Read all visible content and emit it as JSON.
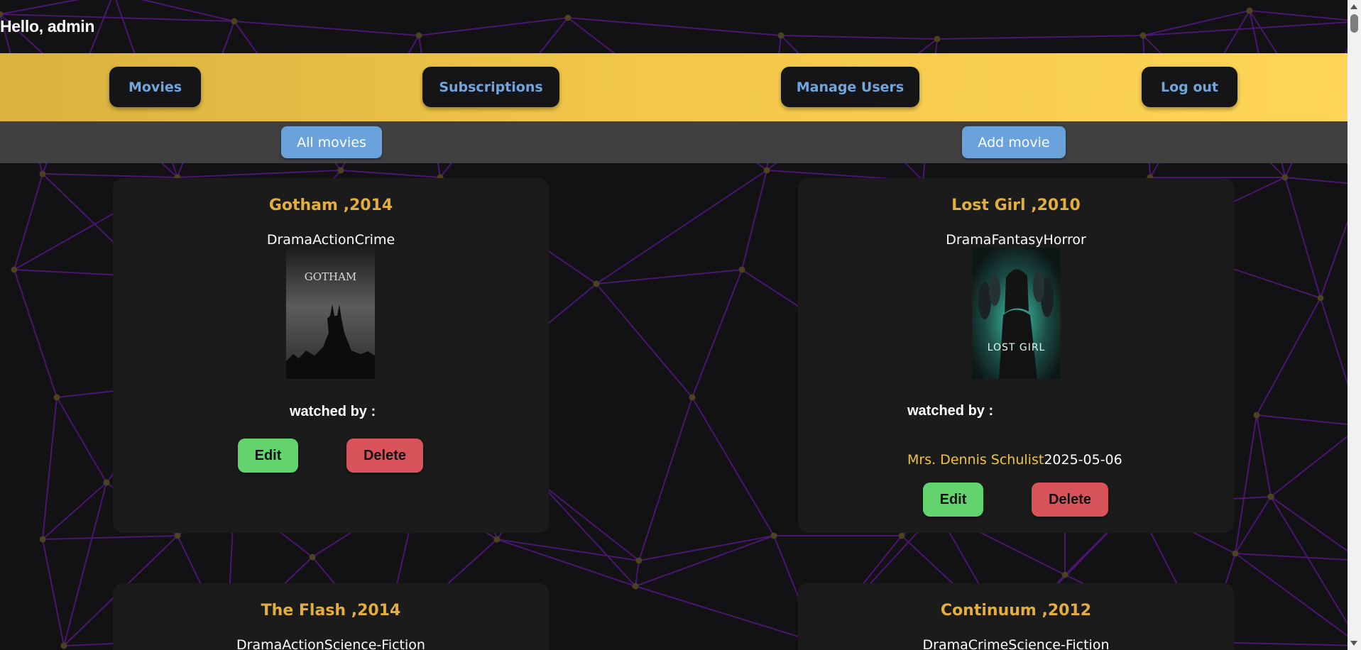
{
  "greeting": "Hello, admin",
  "nav": {
    "movies": "Movies",
    "subscriptions": "Subscriptions",
    "manage_users": "Manage Users",
    "logout": "Log out"
  },
  "subnav": {
    "all_movies": "All movies",
    "add_movie": "Add movie"
  },
  "movies": [
    {
      "title": "Gotham ,2014",
      "genres": "DramaActionCrime",
      "poster_text": "GOTHAM",
      "watched_label": "watched by :",
      "watchers": [],
      "edit_label": "Edit",
      "delete_label": "Delete"
    },
    {
      "title": "Lost Girl ,2010",
      "genres": "DramaFantasyHorror",
      "poster_text": "LOST GIRL",
      "watched_label": "watched by :",
      "watchers": [
        {
          "name": "Mrs. Dennis Schulist",
          "date": "2025-05-06"
        }
      ],
      "edit_label": "Edit",
      "delete_label": "Delete"
    },
    {
      "title": "The Flash ,2014",
      "genres": "DramaActionScience-Fiction"
    },
    {
      "title": "Continuum ,2012",
      "genres": "DramaCrimeScience-Fiction"
    }
  ],
  "colors": {
    "navbar_gradient_start": "#d9b23f",
    "navbar_gradient_end": "#ffd557",
    "accent_title": "#e2ae3d",
    "link_blue": "#6fa6dd",
    "edit_green": "#63d36d",
    "delete_red": "#d9535a",
    "background": "#121113",
    "mesh_line": "#4a1670",
    "mesh_node": "#4a4220"
  }
}
